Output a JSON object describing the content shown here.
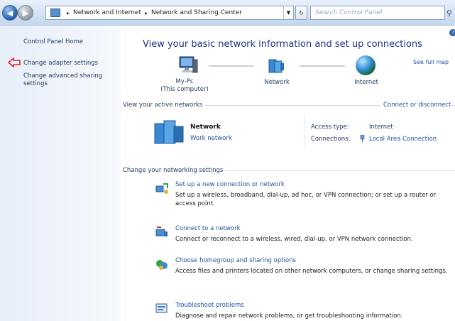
{
  "toolbar": {
    "breadcrumb": [
      "Network and Internet",
      "Network and Sharing Center"
    ],
    "breadcrumb_sep": "▸",
    "search_placeholder": "Search Control Panel"
  },
  "sidebar": {
    "home": "Control Panel Home",
    "items": [
      {
        "label": "Change adapter settings"
      },
      {
        "label": "Change advanced sharing settings"
      }
    ]
  },
  "main": {
    "title": "View your basic network information and set up connections",
    "see_full_map": "See full map",
    "map": {
      "pc_name": "My-Pc",
      "pc_sub": "(This computer)",
      "network": "Network",
      "internet": "Internet"
    },
    "active": {
      "heading": "View your active networks",
      "connect_disconnect": "Connect or disconnect",
      "network_name": "Network",
      "network_type": "Work network",
      "access_type_label": "Access type:",
      "access_type_value": "Internet",
      "connections_label": "Connections:",
      "connections_value": "Local Area Connection"
    },
    "change": {
      "heading": "Change your networking settings",
      "tasks": [
        {
          "link": "Set up a new connection or network",
          "desc": "Set up a wireless, broadband, dial-up, ad hoc, or VPN connection; or set up a router or access point."
        },
        {
          "link": "Connect to a network",
          "desc": "Connect or reconnect to a wireless, wired, dial-up, or VPN network connection."
        },
        {
          "link": "Choose homegroup and sharing options",
          "desc": "Access files and printers located on other network computers, or change sharing settings."
        },
        {
          "link": "Troubleshoot problems",
          "desc": "Diagnose and repair network problems, or get troubleshooting information."
        }
      ]
    }
  },
  "icons": {
    "back": "back-arrow-icon",
    "forward": "forward-arrow-icon",
    "search": "search-icon",
    "computer": "computer-icon",
    "network": "network-icon",
    "internet": "globe-icon"
  },
  "colors": {
    "link": "#1f4e9c",
    "title": "#1e3287",
    "arrow": "#d9232a"
  }
}
